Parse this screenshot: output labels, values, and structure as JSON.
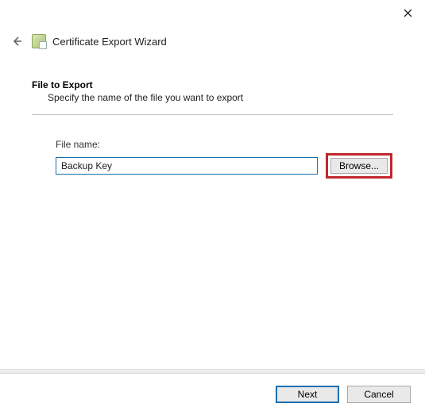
{
  "window": {
    "title": "Certificate Export Wizard"
  },
  "page": {
    "heading": "File to Export",
    "subheading": "Specify the name of the file you want to export"
  },
  "file": {
    "label": "File name:",
    "value": "Backup Key",
    "browse_label": "Browse..."
  },
  "footer": {
    "next_label": "Next",
    "cancel_label": "Cancel"
  }
}
